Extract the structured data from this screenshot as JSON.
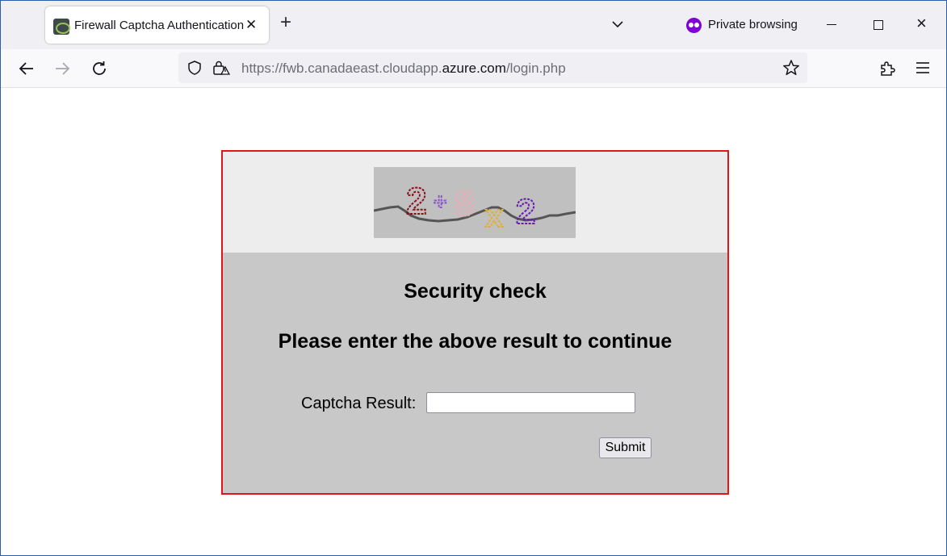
{
  "browser": {
    "tab": {
      "title": "Firewall Captcha Authentication",
      "close_icon": "close-icon",
      "favicon": "site-favicon-icon"
    },
    "new_tab_label": "+",
    "private_label": "Private browsing",
    "url": {
      "prefix": "https://fwb.canadaeast.cloudapp.",
      "domain": "azure.com",
      "suffix": "/login.php"
    },
    "window_controls": {
      "minimize": "minimize-icon",
      "maximize": "maximize-icon",
      "close": "×"
    }
  },
  "page": {
    "captcha_image": {
      "glyphs": [
        {
          "char": "2",
          "color": "#8b0f18"
        },
        {
          "char": "+",
          "color": "#8a56c8"
        },
        {
          "char": "8",
          "color": "#f2a9b5"
        },
        {
          "char": "x",
          "color": "#e0b030"
        },
        {
          "char": "2",
          "color": "#6a1ab0"
        }
      ]
    },
    "heading": "Security check",
    "instruction": "Please enter the above result to continue",
    "form": {
      "label": "Captcha Result:",
      "input_value": "",
      "submit_label": "Submit"
    }
  },
  "colors": {
    "frame_border": "#e5141b",
    "panel_top": "#ededed",
    "panel_body": "#c8c8c8",
    "private_accent": "#8000d7"
  }
}
